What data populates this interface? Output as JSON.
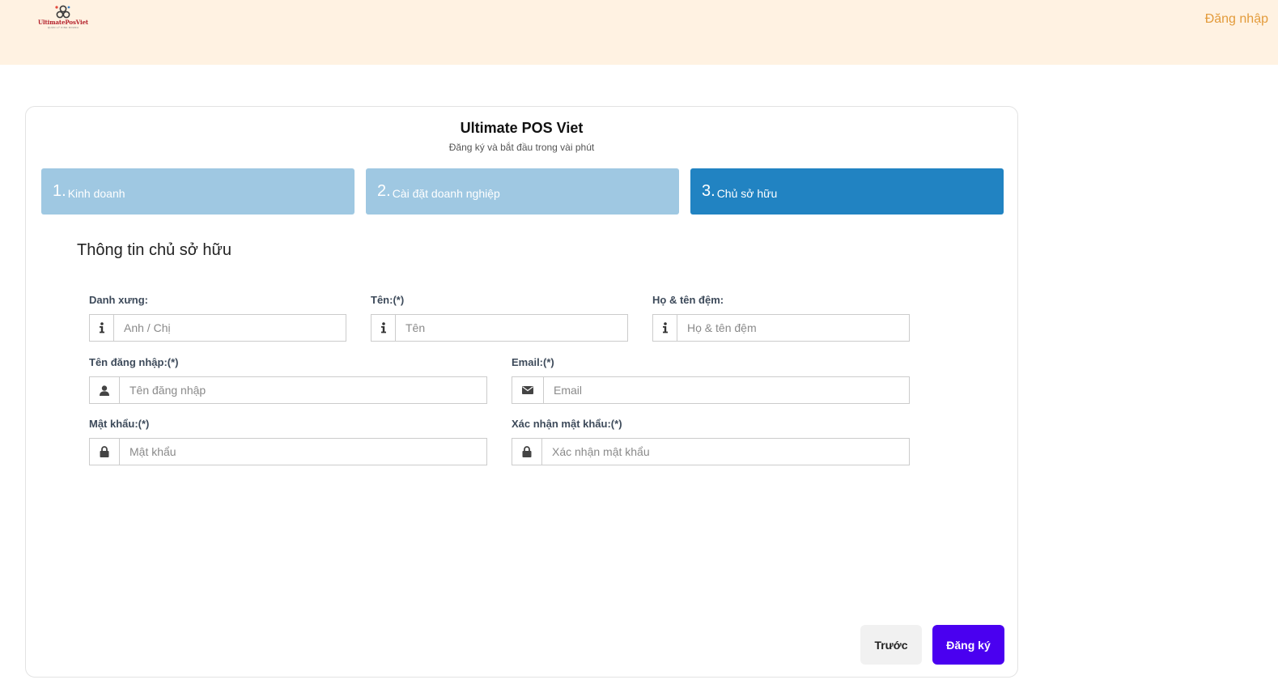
{
  "header": {
    "logo_text": "UltimatePosViet",
    "logo_subtext": "QUẢN LÝ KINH DOANH",
    "login_link": "Đăng nhập"
  },
  "card": {
    "title": "Ultimate POS Viet",
    "subtitle": "Đăng ký và bắt đầu trong vài phút"
  },
  "steps": [
    {
      "number": "1.",
      "label": "Kinh doanh",
      "active": false
    },
    {
      "number": "2.",
      "label": "Cài đặt doanh nghiệp",
      "active": false
    },
    {
      "number": "3.",
      "label": "Chủ sở hữu",
      "active": true
    }
  ],
  "section": {
    "title": "Thông tin chủ sở hữu"
  },
  "fields": {
    "salutation": {
      "label": "Danh xưng:",
      "placeholder": "Anh / Chị",
      "icon": "info-icon"
    },
    "first_name": {
      "label": "Tên:(*)",
      "placeholder": "Tên",
      "icon": "info-icon"
    },
    "last_name": {
      "label": "Họ & tên đệm:",
      "placeholder": "Họ & tên đệm",
      "icon": "info-icon"
    },
    "username": {
      "label": "Tên đăng nhập:(*)",
      "placeholder": "Tên đăng nhập",
      "icon": "user-icon"
    },
    "email": {
      "label": "Email:(*)",
      "placeholder": "Email",
      "icon": "envelope-icon"
    },
    "password": {
      "label": "Mật khẩu:(*)",
      "placeholder": "Mật khẩu",
      "icon": "lock-icon"
    },
    "confirm_password": {
      "label": "Xác nhận mật khẩu:(*)",
      "placeholder": "Xác nhận mật khẩu",
      "icon": "lock-icon"
    }
  },
  "buttons": {
    "previous": "Trước",
    "submit": "Đăng ký"
  },
  "colors": {
    "header_bg": "#fff2e2",
    "login_link": "#e39b3b",
    "step_inactive": "#9fc8e2",
    "step_active": "#2183c2",
    "submit_button": "#4a00f0"
  }
}
